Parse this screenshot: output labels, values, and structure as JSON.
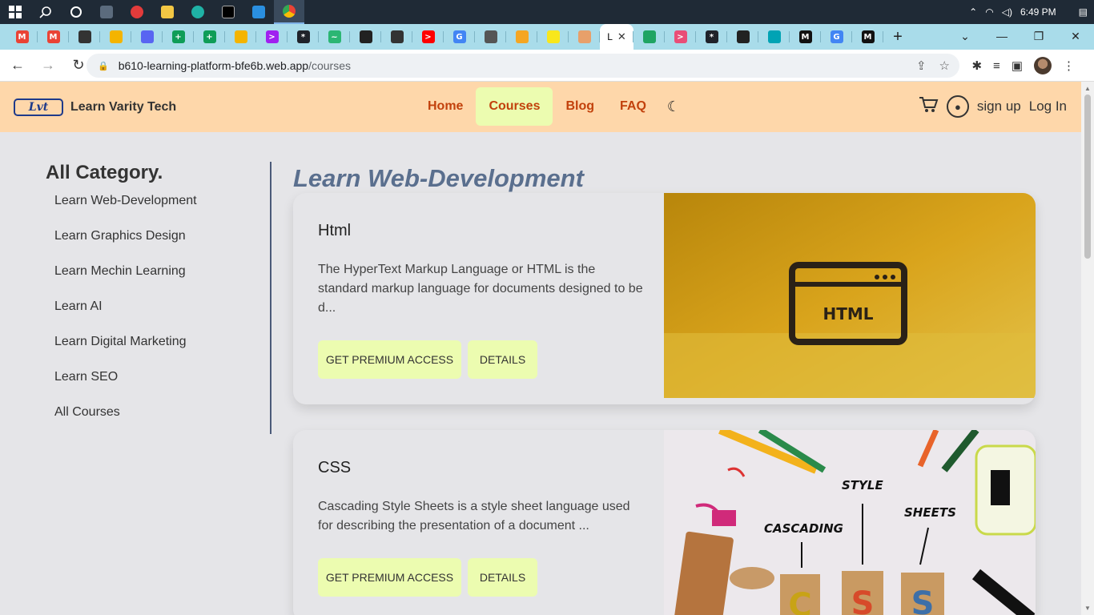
{
  "taskbar": {
    "clock": "6:49 PM",
    "icons": [
      "windows-start-icon",
      "search-icon",
      "cortana-icon",
      "calculator-icon",
      "media-player-icon",
      "file-explorer-icon",
      "edge-icon",
      "terminal-icon",
      "vscode-icon",
      "chrome-icon"
    ]
  },
  "browser": {
    "tabs": [
      {
        "name": "gmail-icon",
        "color": "#ea4335",
        "glyph": "M"
      },
      {
        "name": "gmail-icon",
        "color": "#ea4335",
        "glyph": "M"
      },
      {
        "name": "github-icon",
        "color": "#333333",
        "glyph": ""
      },
      {
        "name": "slides-icon",
        "color": "#f4b400",
        "glyph": ""
      },
      {
        "name": "discord-icon",
        "color": "#5865f2",
        "glyph": ""
      },
      {
        "name": "sheets-icon",
        "color": "#0f9d58",
        "glyph": "+"
      },
      {
        "name": "sheets-icon",
        "color": "#0f9d58",
        "glyph": "+"
      },
      {
        "name": "slides-icon",
        "color": "#f4b400",
        "glyph": ""
      },
      {
        "name": "video-icon",
        "color": "#a020f0",
        "glyph": ">"
      },
      {
        "name": "react-icon",
        "color": "#20232a",
        "glyph": "*"
      },
      {
        "name": "app-icon",
        "color": "#2bb673",
        "glyph": "~"
      },
      {
        "name": "globe-icon",
        "color": "#222222",
        "glyph": ""
      },
      {
        "name": "github-icon",
        "color": "#333333",
        "glyph": ""
      },
      {
        "name": "youtube-icon",
        "color": "#ff0000",
        "glyph": ">"
      },
      {
        "name": "google-icon",
        "color": "#4285f4",
        "glyph": "G"
      },
      {
        "name": "graduation-icon",
        "color": "#555555",
        "glyph": ""
      },
      {
        "name": "flower-icon",
        "color": "#f5a623",
        "glyph": ""
      },
      {
        "name": "bulb-icon",
        "color": "#f8e71c",
        "glyph": ""
      },
      {
        "name": "brand-icon",
        "color": "#e8a06a",
        "glyph": ""
      },
      {
        "name": "drive-icon",
        "color": "#1fa463",
        "glyph": ""
      },
      {
        "name": "arrow-icon",
        "color": "#e94e77",
        "glyph": ">"
      },
      {
        "name": "react-icon",
        "color": "#20232a",
        "glyph": "*"
      },
      {
        "name": "globe-icon",
        "color": "#222222",
        "glyph": ""
      },
      {
        "name": "diamond-icon",
        "color": "#00a3b4",
        "glyph": ""
      },
      {
        "name": "medium-icon",
        "color": "#111111",
        "glyph": "M"
      },
      {
        "name": "google-icon",
        "color": "#4285f4",
        "glyph": "G"
      },
      {
        "name": "medium-icon",
        "color": "#111111",
        "glyph": "M"
      }
    ],
    "active_tab_label": "L",
    "url_domain": "b610-learning-platform-bfe6b.web.app",
    "url_path": "/courses"
  },
  "site": {
    "logo_text": "Lvt",
    "brand": "Learn Varity Tech",
    "menu": [
      "Home",
      "Courses",
      "Blog",
      "FAQ"
    ],
    "active_menu": "Courses",
    "signup": "sign up",
    "login": "Log In"
  },
  "sidebar": {
    "title": "All Category.",
    "items": [
      "Learn Web-Development",
      "Learn Graphics Design",
      "Learn Mechin Learning",
      "Learn AI",
      "Learn Digital Marketing",
      "Learn SEO",
      "All Courses"
    ]
  },
  "main": {
    "section_title": "Learn Web-Development",
    "courses": [
      {
        "title": "Html",
        "description": "The HyperText Markup Language or HTML is the standard markup language for documents designed to be d...",
        "premium_label": "Get Premium Access",
        "details_label": "Details",
        "image_text": "HTML"
      },
      {
        "title": "CSS",
        "description": "Cascading Style Sheets is a style sheet language used for describing the presentation of a document ...",
        "premium_label": "Get Premium Access",
        "details_label": "Details",
        "image_words": [
          "CASCADING",
          "STYLE",
          "SHEETS"
        ],
        "image_blocks": [
          "C",
          "S",
          "S"
        ]
      }
    ]
  }
}
